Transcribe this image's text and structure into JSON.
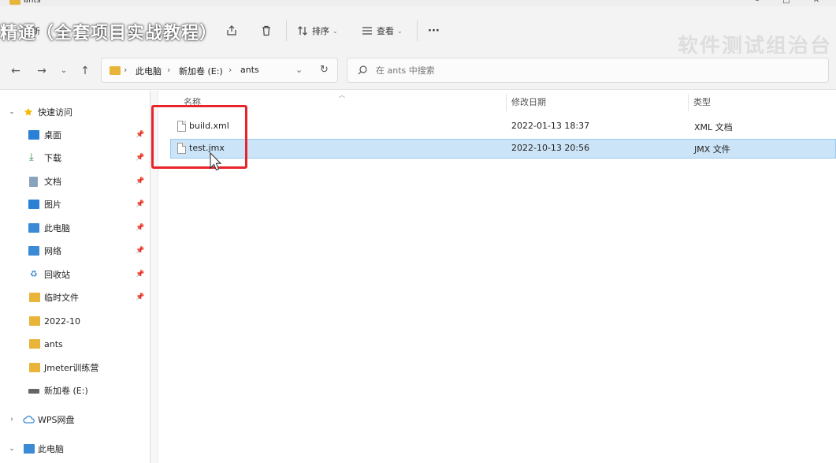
{
  "window": {
    "title": "ants",
    "overlay_caption": "精通（全套项目实战教程）",
    "watermark": "软件测试组治台"
  },
  "toolbar": {
    "new_label": "新",
    "sort_label": "排序",
    "view_label": "查看",
    "more_label": "···"
  },
  "address": {
    "crumbs": [
      "此电脑",
      "新加卷 (E:)",
      "ants"
    ],
    "separator": "›"
  },
  "search": {
    "placeholder": "在 ants 中搜索"
  },
  "sidebar": {
    "quick_access": "快速访问",
    "items": [
      {
        "label": "桌面",
        "icon": "desktop-icon",
        "pinned": true
      },
      {
        "label": "下载",
        "icon": "download-icon",
        "pinned": true
      },
      {
        "label": "文档",
        "icon": "document-icon",
        "pinned": true
      },
      {
        "label": "图片",
        "icon": "picture-icon",
        "pinned": true
      },
      {
        "label": "此电脑",
        "icon": "computer-icon",
        "pinned": true
      },
      {
        "label": "网络",
        "icon": "network-icon",
        "pinned": true
      },
      {
        "label": "回收站",
        "icon": "recycle-bin-icon",
        "pinned": true
      },
      {
        "label": "临时文件",
        "icon": "folder-icon",
        "pinned": true
      },
      {
        "label": "2022-10",
        "icon": "folder-icon",
        "pinned": false
      },
      {
        "label": "ants",
        "icon": "folder-icon",
        "pinned": false
      },
      {
        "label": "Jmeter训练营",
        "icon": "folder-icon",
        "pinned": false
      },
      {
        "label": "新加卷 (E:)",
        "icon": "drive-icon",
        "pinned": false
      }
    ],
    "wps": "WPS网盘",
    "this_pc": "此电脑"
  },
  "table": {
    "columns": [
      "名称",
      "修改日期",
      "类型"
    ],
    "rows": [
      {
        "name": "build.xml",
        "modified": "2022-01-13 18:37",
        "type": "XML 文档",
        "selected": false
      },
      {
        "name": "test.jmx",
        "modified": "2022-10-13 20:56",
        "type": "JMX 文件",
        "selected": true
      }
    ]
  },
  "colors": {
    "selection_bg": "#cce4f7",
    "highlight_border": "#e8232a",
    "folder": "#e8b43a"
  }
}
